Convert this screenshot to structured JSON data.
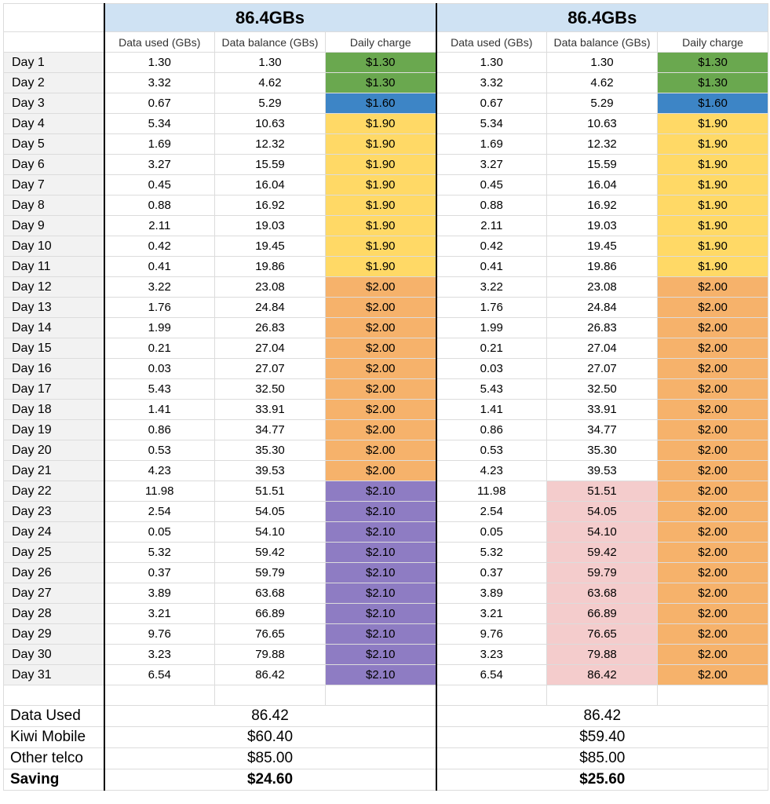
{
  "header": {
    "totals": [
      "86.4GBs",
      "86.4GBs"
    ],
    "subcols": [
      "Data used (GBs)",
      "Data balance (GBs)",
      "Daily charge"
    ]
  },
  "colors": {
    "green": "#6aa84f",
    "blue": "#3d85c6",
    "yellow": "#ffd966",
    "orange": "#f6b26b",
    "purple": "#8e7cc3",
    "pink": "#f4cccc"
  },
  "rows": [
    {
      "label": "Day 1",
      "l": {
        "used": "1.30",
        "bal": "1.30",
        "charge": "$1.30",
        "c_cls": "green"
      },
      "r": {
        "used": "1.30",
        "bal": "1.30",
        "bal_cls": "",
        "charge": "$1.30",
        "c_cls": "green"
      }
    },
    {
      "label": "Day 2",
      "l": {
        "used": "3.32",
        "bal": "4.62",
        "charge": "$1.30",
        "c_cls": "green"
      },
      "r": {
        "used": "3.32",
        "bal": "4.62",
        "bal_cls": "",
        "charge": "$1.30",
        "c_cls": "green"
      }
    },
    {
      "label": "Day 3",
      "l": {
        "used": "0.67",
        "bal": "5.29",
        "charge": "$1.60",
        "c_cls": "blue"
      },
      "r": {
        "used": "0.67",
        "bal": "5.29",
        "bal_cls": "",
        "charge": "$1.60",
        "c_cls": "blue"
      }
    },
    {
      "label": "Day 4",
      "l": {
        "used": "5.34",
        "bal": "10.63",
        "charge": "$1.90",
        "c_cls": "yellow"
      },
      "r": {
        "used": "5.34",
        "bal": "10.63",
        "bal_cls": "",
        "charge": "$1.90",
        "c_cls": "yellow"
      }
    },
    {
      "label": "Day 5",
      "l": {
        "used": "1.69",
        "bal": "12.32",
        "charge": "$1.90",
        "c_cls": "yellow"
      },
      "r": {
        "used": "1.69",
        "bal": "12.32",
        "bal_cls": "",
        "charge": "$1.90",
        "c_cls": "yellow"
      }
    },
    {
      "label": "Day 6",
      "l": {
        "used": "3.27",
        "bal": "15.59",
        "charge": "$1.90",
        "c_cls": "yellow"
      },
      "r": {
        "used": "3.27",
        "bal": "15.59",
        "bal_cls": "",
        "charge": "$1.90",
        "c_cls": "yellow"
      }
    },
    {
      "label": "Day 7",
      "l": {
        "used": "0.45",
        "bal": "16.04",
        "charge": "$1.90",
        "c_cls": "yellow"
      },
      "r": {
        "used": "0.45",
        "bal": "16.04",
        "bal_cls": "",
        "charge": "$1.90",
        "c_cls": "yellow"
      }
    },
    {
      "label": "Day 8",
      "l": {
        "used": "0.88",
        "bal": "16.92",
        "charge": "$1.90",
        "c_cls": "yellow"
      },
      "r": {
        "used": "0.88",
        "bal": "16.92",
        "bal_cls": "",
        "charge": "$1.90",
        "c_cls": "yellow"
      }
    },
    {
      "label": "Day 9",
      "l": {
        "used": "2.11",
        "bal": "19.03",
        "charge": "$1.90",
        "c_cls": "yellow"
      },
      "r": {
        "used": "2.11",
        "bal": "19.03",
        "bal_cls": "",
        "charge": "$1.90",
        "c_cls": "yellow"
      }
    },
    {
      "label": "Day 10",
      "l": {
        "used": "0.42",
        "bal": "19.45",
        "charge": "$1.90",
        "c_cls": "yellow"
      },
      "r": {
        "used": "0.42",
        "bal": "19.45",
        "bal_cls": "",
        "charge": "$1.90",
        "c_cls": "yellow"
      }
    },
    {
      "label": "Day 11",
      "l": {
        "used": "0.41",
        "bal": "19.86",
        "charge": "$1.90",
        "c_cls": "yellow"
      },
      "r": {
        "used": "0.41",
        "bal": "19.86",
        "bal_cls": "",
        "charge": "$1.90",
        "c_cls": "yellow"
      }
    },
    {
      "label": "Day 12",
      "l": {
        "used": "3.22",
        "bal": "23.08",
        "charge": "$2.00",
        "c_cls": "orange"
      },
      "r": {
        "used": "3.22",
        "bal": "23.08",
        "bal_cls": "",
        "charge": "$2.00",
        "c_cls": "orange"
      }
    },
    {
      "label": "Day 13",
      "l": {
        "used": "1.76",
        "bal": "24.84",
        "charge": "$2.00",
        "c_cls": "orange"
      },
      "r": {
        "used": "1.76",
        "bal": "24.84",
        "bal_cls": "",
        "charge": "$2.00",
        "c_cls": "orange"
      }
    },
    {
      "label": "Day 14",
      "l": {
        "used": "1.99",
        "bal": "26.83",
        "charge": "$2.00",
        "c_cls": "orange"
      },
      "r": {
        "used": "1.99",
        "bal": "26.83",
        "bal_cls": "",
        "charge": "$2.00",
        "c_cls": "orange"
      }
    },
    {
      "label": "Day 15",
      "l": {
        "used": "0.21",
        "bal": "27.04",
        "charge": "$2.00",
        "c_cls": "orange"
      },
      "r": {
        "used": "0.21",
        "bal": "27.04",
        "bal_cls": "",
        "charge": "$2.00",
        "c_cls": "orange"
      }
    },
    {
      "label": "Day 16",
      "l": {
        "used": "0.03",
        "bal": "27.07",
        "charge": "$2.00",
        "c_cls": "orange"
      },
      "r": {
        "used": "0.03",
        "bal": "27.07",
        "bal_cls": "",
        "charge": "$2.00",
        "c_cls": "orange"
      }
    },
    {
      "label": "Day 17",
      "l": {
        "used": "5.43",
        "bal": "32.50",
        "charge": "$2.00",
        "c_cls": "orange"
      },
      "r": {
        "used": "5.43",
        "bal": "32.50",
        "bal_cls": "",
        "charge": "$2.00",
        "c_cls": "orange"
      }
    },
    {
      "label": "Day 18",
      "l": {
        "used": "1.41",
        "bal": "33.91",
        "charge": "$2.00",
        "c_cls": "orange"
      },
      "r": {
        "used": "1.41",
        "bal": "33.91",
        "bal_cls": "",
        "charge": "$2.00",
        "c_cls": "orange"
      }
    },
    {
      "label": "Day 19",
      "l": {
        "used": "0.86",
        "bal": "34.77",
        "charge": "$2.00",
        "c_cls": "orange"
      },
      "r": {
        "used": "0.86",
        "bal": "34.77",
        "bal_cls": "",
        "charge": "$2.00",
        "c_cls": "orange"
      }
    },
    {
      "label": "Day 20",
      "l": {
        "used": "0.53",
        "bal": "35.30",
        "charge": "$2.00",
        "c_cls": "orange"
      },
      "r": {
        "used": "0.53",
        "bal": "35.30",
        "bal_cls": "",
        "charge": "$2.00",
        "c_cls": "orange"
      }
    },
    {
      "label": "Day 21",
      "l": {
        "used": "4.23",
        "bal": "39.53",
        "charge": "$2.00",
        "c_cls": "orange"
      },
      "r": {
        "used": "4.23",
        "bal": "39.53",
        "bal_cls": "",
        "charge": "$2.00",
        "c_cls": "orange"
      }
    },
    {
      "label": "Day 22",
      "l": {
        "used": "11.98",
        "bal": "51.51",
        "charge": "$2.10",
        "c_cls": "purple"
      },
      "r": {
        "used": "11.98",
        "bal": "51.51",
        "bal_cls": "pink",
        "charge": "$2.00",
        "c_cls": "orange"
      }
    },
    {
      "label": "Day 23",
      "l": {
        "used": "2.54",
        "bal": "54.05",
        "charge": "$2.10",
        "c_cls": "purple"
      },
      "r": {
        "used": "2.54",
        "bal": "54.05",
        "bal_cls": "pink",
        "charge": "$2.00",
        "c_cls": "orange"
      }
    },
    {
      "label": "Day 24",
      "l": {
        "used": "0.05",
        "bal": "54.10",
        "charge": "$2.10",
        "c_cls": "purple"
      },
      "r": {
        "used": "0.05",
        "bal": "54.10",
        "bal_cls": "pink",
        "charge": "$2.00",
        "c_cls": "orange"
      }
    },
    {
      "label": "Day 25",
      "l": {
        "used": "5.32",
        "bal": "59.42",
        "charge": "$2.10",
        "c_cls": "purple"
      },
      "r": {
        "used": "5.32",
        "bal": "59.42",
        "bal_cls": "pink",
        "charge": "$2.00",
        "c_cls": "orange"
      }
    },
    {
      "label": "Day 26",
      "l": {
        "used": "0.37",
        "bal": "59.79",
        "charge": "$2.10",
        "c_cls": "purple"
      },
      "r": {
        "used": "0.37",
        "bal": "59.79",
        "bal_cls": "pink",
        "charge": "$2.00",
        "c_cls": "orange"
      }
    },
    {
      "label": "Day 27",
      "l": {
        "used": "3.89",
        "bal": "63.68",
        "charge": "$2.10",
        "c_cls": "purple"
      },
      "r": {
        "used": "3.89",
        "bal": "63.68",
        "bal_cls": "pink",
        "charge": "$2.00",
        "c_cls": "orange"
      }
    },
    {
      "label": "Day 28",
      "l": {
        "used": "3.21",
        "bal": "66.89",
        "charge": "$2.10",
        "c_cls": "purple"
      },
      "r": {
        "used": "3.21",
        "bal": "66.89",
        "bal_cls": "pink",
        "charge": "$2.00",
        "c_cls": "orange"
      }
    },
    {
      "label": "Day 29",
      "l": {
        "used": "9.76",
        "bal": "76.65",
        "charge": "$2.10",
        "c_cls": "purple"
      },
      "r": {
        "used": "9.76",
        "bal": "76.65",
        "bal_cls": "pink",
        "charge": "$2.00",
        "c_cls": "orange"
      }
    },
    {
      "label": "Day 30",
      "l": {
        "used": "3.23",
        "bal": "79.88",
        "charge": "$2.10",
        "c_cls": "purple"
      },
      "r": {
        "used": "3.23",
        "bal": "79.88",
        "bal_cls": "pink",
        "charge": "$2.00",
        "c_cls": "orange"
      }
    },
    {
      "label": "Day 31",
      "l": {
        "used": "6.54",
        "bal": "86.42",
        "charge": "$2.10",
        "c_cls": "purple"
      },
      "r": {
        "used": "6.54",
        "bal": "86.42",
        "bal_cls": "pink",
        "charge": "$2.00",
        "c_cls": "orange"
      }
    }
  ],
  "summary": [
    {
      "label": "Data Used",
      "left": "86.42",
      "right": "86.42",
      "bold": false
    },
    {
      "label": "Kiwi Mobile",
      "left": "$60.40",
      "right": "$59.40",
      "bold": false
    },
    {
      "label": "Other telco",
      "left": "$85.00",
      "right": "$85.00",
      "bold": false
    },
    {
      "label": "Saving",
      "left": "$24.60",
      "right": "$25.60",
      "bold": true
    }
  ]
}
